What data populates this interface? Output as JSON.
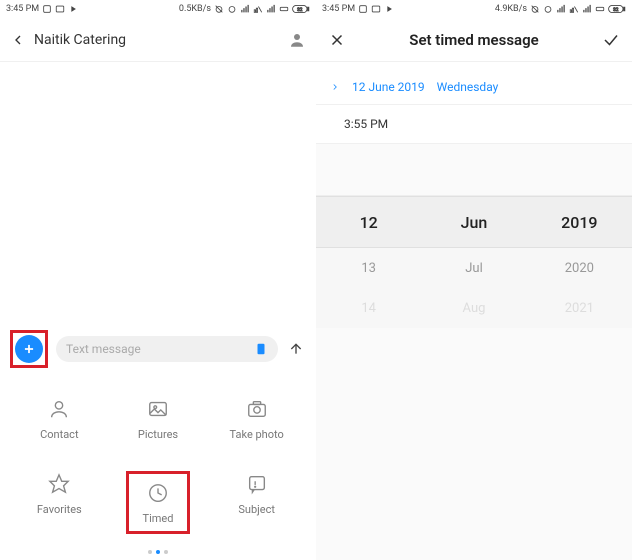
{
  "status": {
    "time": "3:45 PM",
    "speed_l": "0.5KB/s",
    "speed_r": "4.9KB/s",
    "battery": "32"
  },
  "left": {
    "contact": "Naitik Catering",
    "input_placeholder": "Text message",
    "attach": {
      "contact": "Contact",
      "pictures": "Pictures",
      "take_photo": "Take photo",
      "favorites": "Favorites",
      "timed": "Timed",
      "subject": "Subject"
    }
  },
  "right": {
    "title": "Set timed message",
    "date": "12 June 2019",
    "weekday": "Wednesday",
    "time": "3:55 PM",
    "picker": {
      "day_sel": "12",
      "mon_sel": "Jun",
      "yr_sel": "2019",
      "day_1": "13",
      "mon_1": "Jul",
      "yr_1": "2020",
      "day_2": "14",
      "mon_2": "Aug",
      "yr_2": "2021"
    }
  }
}
